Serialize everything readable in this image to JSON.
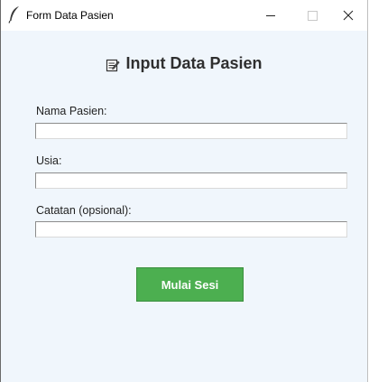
{
  "window": {
    "title": "Form Data Pasien",
    "controls": {
      "minimize": "minimize-icon",
      "maximize": "maximize-icon",
      "close": "close-icon"
    },
    "app_icon": "feather-icon"
  },
  "form": {
    "heading": "Input Data Pasien",
    "heading_icon": "memo-icon",
    "fields": [
      {
        "label": "Nama Pasien:",
        "value": "",
        "placeholder": ""
      },
      {
        "label": "Usia:",
        "value": "",
        "placeholder": ""
      },
      {
        "label": "Catatan (opsional):",
        "value": "",
        "placeholder": ""
      }
    ],
    "submit_label": "Mulai Sesi"
  },
  "colors": {
    "background": "#f0f6fc",
    "button": "#4caf50",
    "button_text": "#ffffff"
  }
}
